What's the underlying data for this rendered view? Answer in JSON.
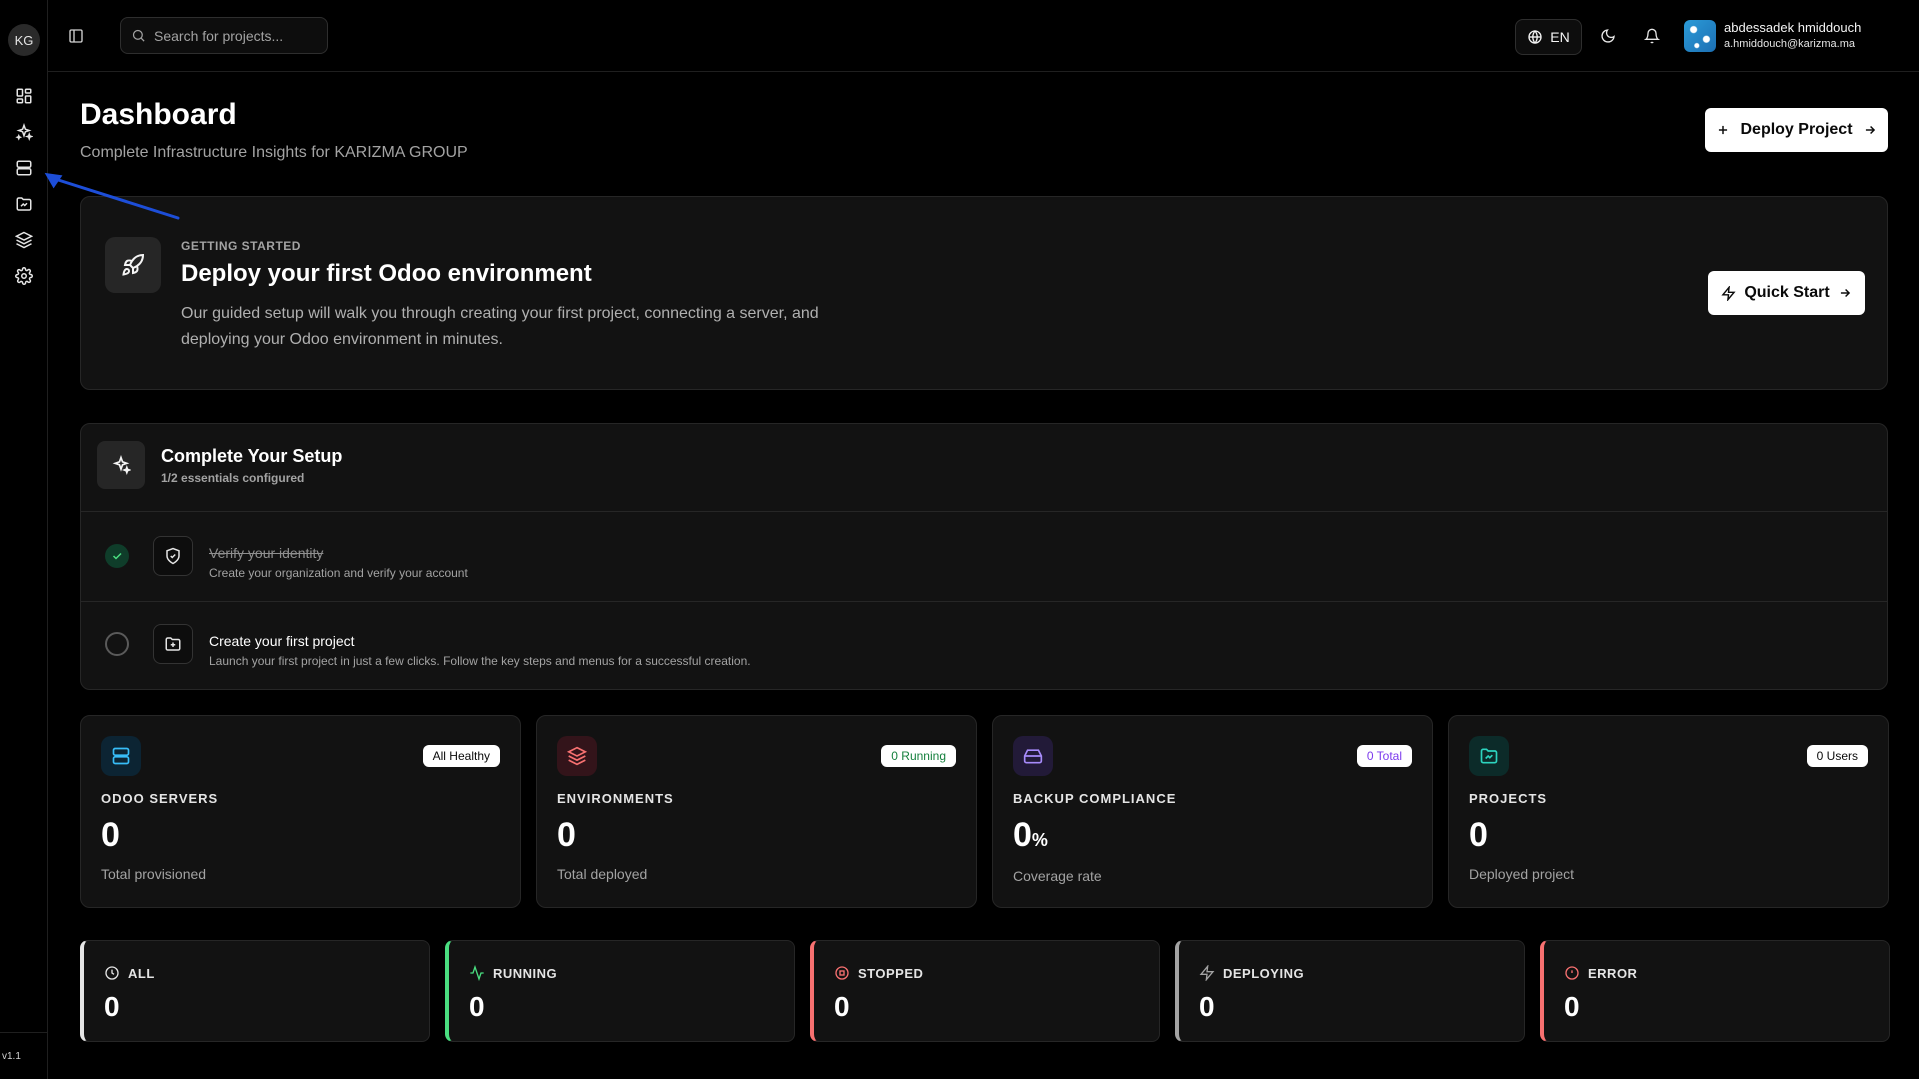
{
  "sidebar": {
    "org_initials": "KG",
    "icons": [
      "dashboard-icon",
      "sparkles-icon",
      "servers-icon",
      "projects-folder-icon",
      "layers-icon",
      "settings-icon"
    ],
    "version": "v1.1"
  },
  "header": {
    "search_placeholder": "Search for projects...",
    "language": "EN",
    "user": {
      "name": "abdessadek hmiddouch",
      "email": "a.hmiddouch@karizma.ma"
    }
  },
  "page": {
    "title": "Dashboard",
    "subtitle": "Complete Infrastructure Insights for KARIZMA GROUP",
    "deploy_button": "Deploy Project"
  },
  "getting_started": {
    "kicker": "GETTING STARTED",
    "title": "Deploy your first Odoo environment",
    "description": "Our guided setup will walk you through creating your first project, connecting a server, and deploying your Odoo environment in minutes.",
    "button": "Quick Start"
  },
  "setup": {
    "title": "Complete Your Setup",
    "progress": "1/2 essentials configured",
    "steps": [
      {
        "title": "Verify your identity",
        "description": "Create your organization and verify your account",
        "done": true
      },
      {
        "title": "Create your first project",
        "description": "Launch your first project in just a few clicks. Follow the key steps and menus for a successful creation.",
        "done": false
      }
    ]
  },
  "stats": [
    {
      "label": "ODOO SERVERS",
      "value": "0",
      "unit": "",
      "caption": "Total provisioned",
      "badge": "All Healthy",
      "color": "#38bdf8"
    },
    {
      "label": "ENVIRONMENTS",
      "value": "0",
      "unit": "",
      "caption": "Total deployed",
      "badge": "0 Running",
      "color": "#f87171"
    },
    {
      "label": "BACKUP COMPLIANCE",
      "value": "0",
      "unit": "%",
      "caption": "Coverage rate",
      "badge": "0 Total",
      "color": "#a78bfa"
    },
    {
      "label": "PROJECTS",
      "value": "0",
      "unit": "",
      "caption": "Deployed project",
      "badge": "0 Users",
      "color": "#2dd4bf"
    }
  ],
  "statuses": [
    {
      "label": "ALL",
      "value": "0",
      "color": "#e5e5e5"
    },
    {
      "label": "RUNNING",
      "value": "0",
      "color": "#4ade80"
    },
    {
      "label": "STOPPED",
      "value": "0",
      "color": "#f87171"
    },
    {
      "label": "DEPLOYING",
      "value": "0",
      "color": "#a3a3a3"
    },
    {
      "label": "ERROR",
      "value": "0",
      "color": "#f87171"
    }
  ],
  "colors": {
    "background": "#000000",
    "card": "#121212",
    "border": "#262626",
    "annotation_arrow": "#1d4ed8",
    "success": "#4ade80",
    "danger": "#f87171"
  }
}
